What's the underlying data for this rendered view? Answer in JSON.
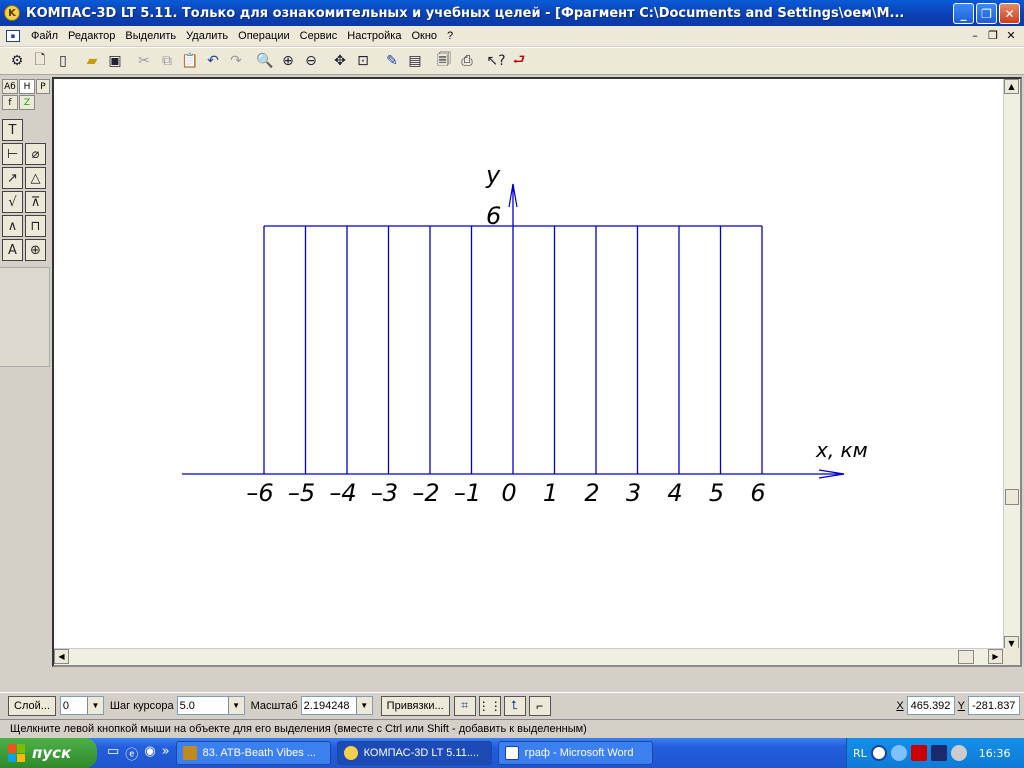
{
  "window": {
    "title": "КОМПАС-3D LT 5.11. Только для ознакомительных и учебных целей - [Фрагмент C:\\Documents and Settings\\оем\\М..."
  },
  "menu": {
    "items": [
      "Файл",
      "Редактор",
      "Выделить",
      "Удалить",
      "Операции",
      "Сервис",
      "Настройка",
      "Окно",
      "?"
    ]
  },
  "toolbar": {
    "icons": [
      "gear-icon",
      "new-doc-icon",
      "new-sheet-icon",
      "open-folder-icon",
      "save-icon",
      "cut-icon",
      "copy-icon",
      "paste-icon",
      "undo-icon",
      "redo-icon",
      "zoom-icon",
      "zoom-in-icon",
      "zoom-out-icon",
      "pan-icon",
      "zoom-window-icon",
      "properties-icon",
      "layers-icon",
      "print-preview-icon",
      "print-icon",
      "help-icon",
      "exit-icon"
    ]
  },
  "left_panel": {
    "tabs": [
      "Aб",
      "H",
      "P",
      "f",
      "Z"
    ]
  },
  "drawing": {
    "y_label": "y",
    "x_label": "x, км",
    "line_height_value": "6",
    "x_ticks": [
      -6,
      -5,
      -4,
      -3,
      -2,
      -1,
      0,
      1,
      2,
      3,
      4,
      5,
      6
    ],
    "tick_labels": [
      "–6",
      "–5",
      "–4",
      "–3",
      "–2",
      "–1",
      "0",
      "1",
      "2",
      "3",
      "4",
      "5",
      "6"
    ],
    "line_color": "#0000cc"
  },
  "property_bar": {
    "layer_button": "Слой...",
    "layer_value": "0",
    "step_label": "Шаг курсора",
    "step_value": "5.0",
    "scale_label": "Масштаб",
    "scale_value": "2.194248",
    "snaps_button": "Привязки...",
    "x_label": "X",
    "x_value": "465.392",
    "y_label": "Y",
    "y_value": "-281.837"
  },
  "status": {
    "text": "Щелкните левой кнопкой мыши на объекте для его выделения (вместе с Ctrl или Shift - добавить к выделенным)"
  },
  "taskbar": {
    "start": "пуск",
    "tasks": [
      "83. ATB-Beath Vibes ...",
      "КОМПАС-3D LT 5.11....",
      "граф - Microsoft Word"
    ],
    "lang": "RL",
    "time": "16:36"
  }
}
